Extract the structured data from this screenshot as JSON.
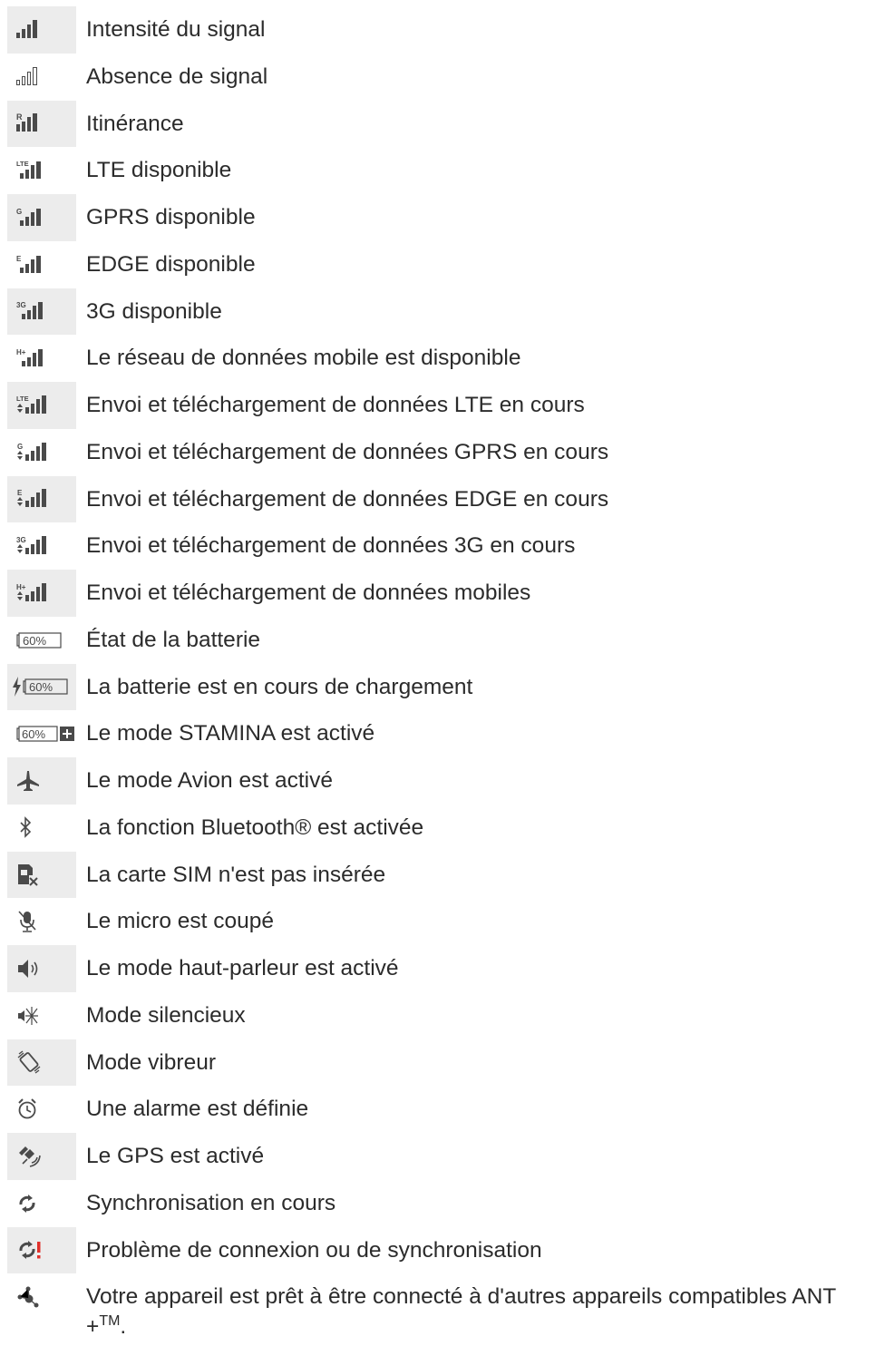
{
  "rows": [
    {
      "icon": "signal-strength-icon",
      "label": "Intensité du signal"
    },
    {
      "icon": "no-signal-icon",
      "label": "Absence de signal"
    },
    {
      "icon": "roaming-icon",
      "label": "Itinérance"
    },
    {
      "icon": "lte-available-icon",
      "label": "LTE disponible"
    },
    {
      "icon": "gprs-available-icon",
      "label": "GPRS disponible"
    },
    {
      "icon": "edge-available-icon",
      "label": "EDGE disponible"
    },
    {
      "icon": "3g-available-icon",
      "label": "3G disponible"
    },
    {
      "icon": "mobile-data-available-icon",
      "label": "Le réseau de données mobile est disponible"
    },
    {
      "icon": "lte-transfer-icon",
      "label": "Envoi et téléchargement de données LTE en cours"
    },
    {
      "icon": "gprs-transfer-icon",
      "label": "Envoi et téléchargement de données GPRS en cours"
    },
    {
      "icon": "edge-transfer-icon",
      "label": "Envoi et téléchargement de données EDGE en cours"
    },
    {
      "icon": "3g-transfer-icon",
      "label": "Envoi et téléchargement de données 3G en cours"
    },
    {
      "icon": "mobile-data-transfer-icon",
      "label": "Envoi et téléchargement de données mobiles"
    },
    {
      "icon": "battery-status-icon",
      "label": "État de la batterie",
      "icon_text": "60%"
    },
    {
      "icon": "battery-charging-icon",
      "label": "La batterie est en cours de chargement",
      "icon_text": "60%"
    },
    {
      "icon": "stamina-mode-icon",
      "label": "Le mode STAMINA est activé",
      "icon_text": "60%"
    },
    {
      "icon": "airplane-mode-icon",
      "label": "Le mode Avion est activé"
    },
    {
      "icon": "bluetooth-icon",
      "label": "La fonction Bluetooth® est activée"
    },
    {
      "icon": "no-sim-icon",
      "label": "La carte SIM n'est pas insérée"
    },
    {
      "icon": "microphone-muted-icon",
      "label": "Le micro est coupé"
    },
    {
      "icon": "speakerphone-icon",
      "label": "Le mode haut-parleur est activé"
    },
    {
      "icon": "silent-mode-icon",
      "label": "Mode silencieux"
    },
    {
      "icon": "vibrate-mode-icon",
      "label": "Mode vibreur"
    },
    {
      "icon": "alarm-icon",
      "label": "Une alarme est définie"
    },
    {
      "icon": "gps-icon",
      "label": "Le GPS est activé"
    },
    {
      "icon": "sync-icon",
      "label": "Synchronisation en cours"
    },
    {
      "icon": "sync-problem-icon",
      "label": "Problème de connexion ou de synchronisation"
    },
    {
      "icon": "ant-plus-icon",
      "label": "Votre appareil est prêt à être connecté à d'autres appareils compatibles ANT +",
      "label_suffix": "TM",
      "label_end": "."
    }
  ],
  "colors": {
    "shade": "#ececec",
    "icon": "#4a4a4a",
    "text": "#2b2b2b",
    "alert": "#e0302a"
  }
}
